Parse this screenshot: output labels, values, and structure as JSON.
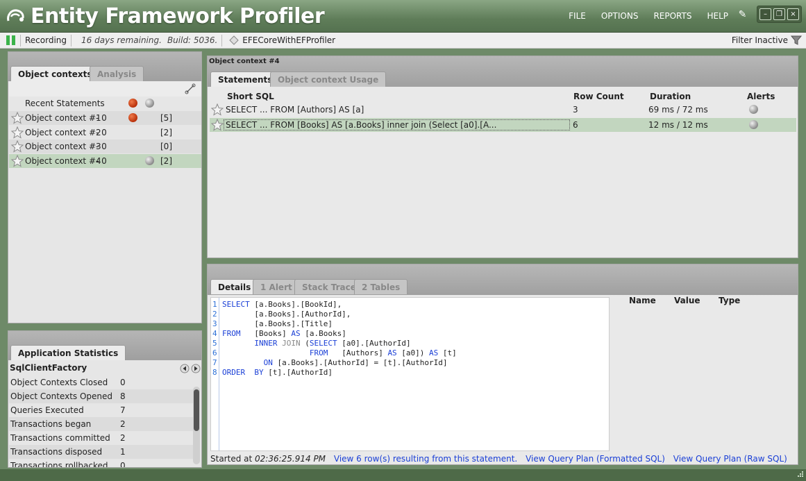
{
  "app": {
    "title": "Entity Framework Profiler",
    "menu": [
      "FILE",
      "OPTIONS",
      "REPORTS",
      "HELP"
    ]
  },
  "status": {
    "recording": "Recording",
    "remaining": "16 days remaining.",
    "build": "Build: 5036.",
    "project": "EFECoreWithEFProfiler",
    "filter": "Filter Inactive"
  },
  "left": {
    "tabs": [
      "Object contexts",
      "Analysis"
    ],
    "recent": "Recent Statements",
    "contexts": [
      {
        "label": "Object context #1",
        "count": "- 0",
        "bracket": "[5]"
      },
      {
        "label": "Object context #2",
        "count": "- 0",
        "bracket": "[2]"
      },
      {
        "label": "Object context #3",
        "count": "- 0",
        "bracket": "[0]"
      },
      {
        "label": "Object context #4",
        "count": "- 0",
        "bracket": "[2]"
      }
    ]
  },
  "stats": {
    "tab": "Application Statistics",
    "factory": "SqlClientFactory",
    "rows": [
      {
        "name": "Object Contexts Closed",
        "value": "0"
      },
      {
        "name": "Object Contexts Opened",
        "value": "8"
      },
      {
        "name": "Queries Executed",
        "value": "7"
      },
      {
        "name": "Transactions began",
        "value": "2"
      },
      {
        "name": "Transactions committed",
        "value": "2"
      },
      {
        "name": "Transactions disposed",
        "value": "1"
      },
      {
        "name": "Transactions rollbacked",
        "value": "0"
      }
    ]
  },
  "statements": {
    "context_title": "Object context #4",
    "tabs": [
      "Statements",
      "Object context Usage"
    ],
    "columns": [
      "Short SQL",
      "Row Count",
      "Duration",
      "Alerts"
    ],
    "rows": [
      {
        "sql": "SELECT ... FROM [Authors] AS [a]",
        "rows": "3",
        "duration": "69 ms / 72 ms"
      },
      {
        "sql": "SELECT ... FROM [Books] AS [a.Books] inner join (Select [a0].[A...",
        "rows": "6",
        "duration": "12 ms / 12 ms"
      }
    ]
  },
  "details": {
    "tabs": [
      "Details",
      "1 Alert",
      "Stack Trace",
      "2 Tables"
    ],
    "param_columns": [
      "Name",
      "Value",
      "Type"
    ],
    "line_numbers": [
      "1",
      "2",
      "3",
      "4",
      "5",
      "6",
      "7",
      "8"
    ],
    "started_label": "Started at",
    "started_time": "02:36:25.914 PM",
    "links": [
      "View 6 row(s) resulting from this statement.",
      "View Query Plan (Formatted SQL)",
      "View Query Plan (Raw SQL)"
    ]
  },
  "colors": {
    "accent_green": "#5f7d59",
    "selected_row": "#c2d6bf",
    "sql_keyword": "#1a3fd6"
  }
}
